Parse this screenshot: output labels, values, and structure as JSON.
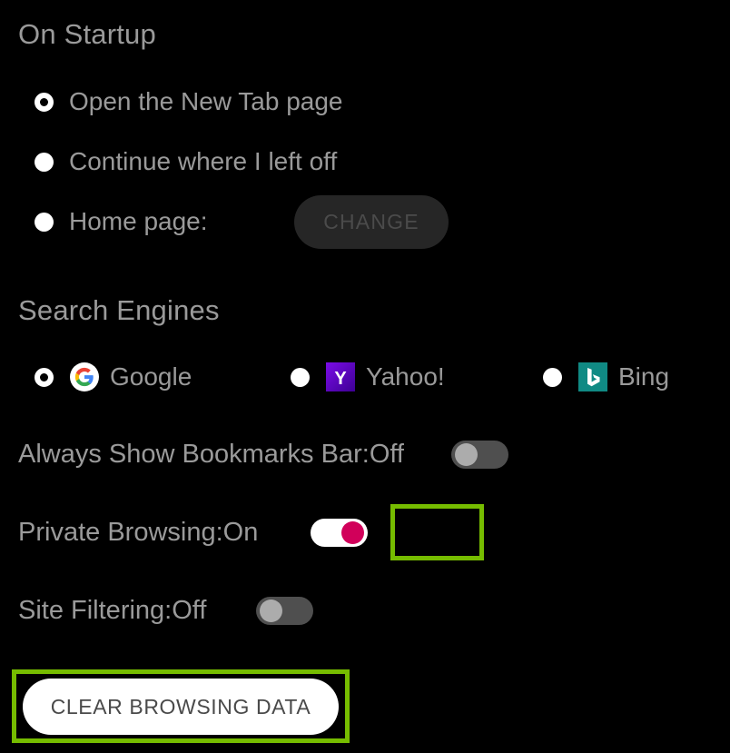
{
  "colors": {
    "background": "#000000",
    "text": "#9a9a9a",
    "highlight_green": "#76bc00",
    "toggle_on_track": "#ffffff",
    "toggle_on_knob": "#d1005a",
    "toggle_off_track": "#4f4f4f",
    "toggle_off_knob": "#acacac",
    "change_button_bg": "#262626",
    "change_button_text": "#4b4b4b",
    "clear_button_bg": "#ffffff",
    "clear_button_text": "#4a4a4a",
    "yahoo_purple": "#5f01d1",
    "bing_teal": "#108a84"
  },
  "startup": {
    "heading": "On Startup",
    "options": [
      {
        "label": "Open the New Tab page",
        "selected": true
      },
      {
        "label": "Continue where I left off",
        "selected": false
      },
      {
        "label": "Home page:",
        "selected": false
      }
    ],
    "change_button_label": "CHANGE"
  },
  "search_engines": {
    "heading": "Search Engines",
    "options": [
      {
        "label": "Google",
        "icon": "google-icon",
        "selected": true
      },
      {
        "label": "Yahoo!",
        "icon": "yahoo-icon",
        "selected": false
      },
      {
        "label": "Bing",
        "icon": "bing-icon",
        "selected": false
      }
    ]
  },
  "settings": [
    {
      "label": "Always Show Bookmarks Bar",
      "separator": " : ",
      "value": "Off",
      "toggle_state": "off",
      "highlighted": false
    },
    {
      "label": "Private Browsing",
      "separator": " : ",
      "value": "On",
      "toggle_state": "on",
      "highlighted": true
    },
    {
      "label": "Site Filtering",
      "separator": " : ",
      "value": "Off",
      "toggle_state": "off",
      "highlighted": false
    }
  ],
  "actions": {
    "clear_browsing_data_label": "CLEAR BROWSING DATA"
  }
}
